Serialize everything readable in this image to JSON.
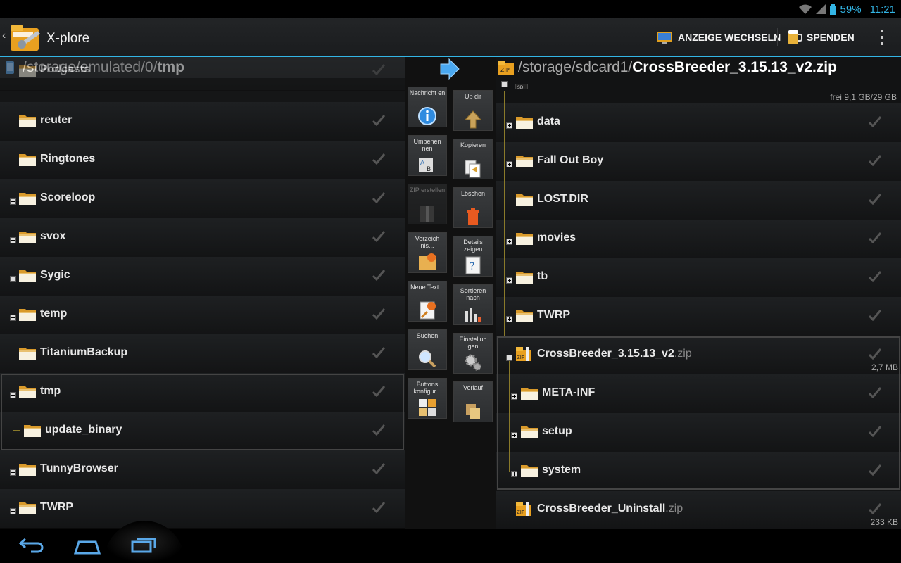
{
  "status": {
    "battery": "59%",
    "time": "11:21"
  },
  "app": {
    "title": "X-plore"
  },
  "actions": {
    "switch_view": "ANZEIGE WECHSELN",
    "donate": "SPENDEN"
  },
  "left": {
    "path_prefix": "/storage/emulated/0/",
    "path_current": "tmp",
    "items": [
      {
        "name": "Podcasts"
      },
      {
        "name": "reuter"
      },
      {
        "name": "Ringtones"
      },
      {
        "name": "Scoreloop"
      },
      {
        "name": "svox"
      },
      {
        "name": "Sygic"
      },
      {
        "name": "temp"
      },
      {
        "name": "TitaniumBackup"
      },
      {
        "name": "tmp"
      },
      {
        "name": "update_binary"
      },
      {
        "name": "TunnyBrowser"
      },
      {
        "name": "TWRP"
      }
    ]
  },
  "tools": [
    {
      "label": "Nachricht en",
      "icon": "info-icon"
    },
    {
      "label": "Up dir",
      "icon": "up-arrow-icon"
    },
    {
      "label": "Umbenen nen",
      "icon": "rename-icon"
    },
    {
      "label": "Kopieren",
      "icon": "copy-icon"
    },
    {
      "label": "ZIP erstellen",
      "icon": "zip-icon"
    },
    {
      "label": "Löschen",
      "icon": "trash-icon"
    },
    {
      "label": "Verzeich nis...",
      "icon": "new-folder-icon"
    },
    {
      "label": "Details zeigen",
      "icon": "details-icon"
    },
    {
      "label": "Neue Text...",
      "icon": "new-text-icon"
    },
    {
      "label": "Sortieren nach",
      "icon": "sort-icon"
    },
    {
      "label": "Suchen",
      "icon": "search-icon"
    },
    {
      "label": "Einstellun gen",
      "icon": "settings-icon"
    },
    {
      "label": "Buttons konfigur...",
      "icon": "buttons-icon"
    },
    {
      "label": "Verlauf",
      "icon": "history-icon"
    }
  ],
  "right": {
    "path_prefix": "/storage/sdcard1/",
    "path_current": "CrossBreeder_3.15.13_v2.zip",
    "free_space": "frei 9,1 GB/29 GB",
    "items": [
      {
        "name": "data"
      },
      {
        "name": "Fall Out Boy"
      },
      {
        "name": "LOST.DIR"
      },
      {
        "name": "movies"
      },
      {
        "name": "tb"
      },
      {
        "name": "TWRP"
      },
      {
        "name": "CrossBreeder_3.15.13_v2",
        "ext": ".zip",
        "size": "2,7 MB"
      },
      {
        "name": "META-INF"
      },
      {
        "name": "setup"
      },
      {
        "name": "system"
      },
      {
        "name": "CrossBreeder_Uninstall",
        "ext": ".zip",
        "size": "233 KB"
      }
    ]
  }
}
